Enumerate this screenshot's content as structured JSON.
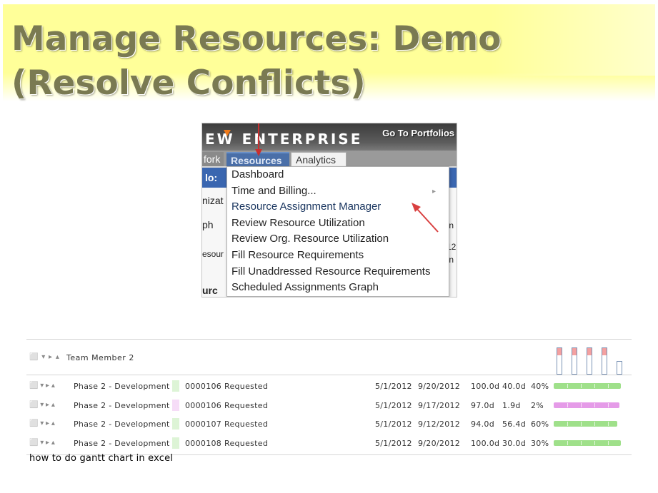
{
  "slide": {
    "title_line1": "Manage Resources: Demo",
    "title_line2": "(Resolve Conflicts)"
  },
  "app": {
    "brand": "EW ENTERPRISE",
    "go_to_portfolios": "Go To Portfolios",
    "tabs": [
      "fork",
      "Resources",
      "Analytics"
    ],
    "behind_fragments": [
      "lo:",
      "nizat",
      "ph",
      "esour",
      "urc",
      "In",
      "12",
      "In"
    ],
    "menu": {
      "items": [
        "Dashboard",
        "Time and Billing...",
        "Resource Assignment Manager",
        "Review Resource Utilization",
        "Review Org. Resource Utilization",
        "Fill Resource Requirements",
        "Fill Unaddressed Resource Requirements",
        "Scheduled Assignments Graph"
      ],
      "highlighted_item": "Resource Assignment Manager",
      "submenu_glyph": "▸"
    },
    "colors": {
      "resources_tab": "#4a6fa8",
      "annotation_arrow": "#d94040",
      "brand_mark": "#f07a1a"
    }
  },
  "gantt": {
    "group_row": {
      "controls": "⬜ ▾ ▸ ▴",
      "label": "Team Member 2",
      "histogram_levels": [
        1.0,
        1.0,
        1.0,
        1.0,
        0.5
      ]
    },
    "rows": [
      {
        "phase": "Phase 2 - Development",
        "id": "0000106",
        "status": "Requested",
        "start": "5/1/2012",
        "finish": "9/20/2012",
        "work": "100.0d",
        "actual": "40.0d",
        "pct": "40%",
        "color": "#9fe08a",
        "bar_fraction": 1.0
      },
      {
        "phase": "Phase 2 - Development",
        "id": "0000106",
        "status": "Requested",
        "start": "5/1/2012",
        "finish": "9/17/2012",
        "work": "97.0d",
        "actual": "1.9d",
        "pct": "2%",
        "color": "#e59be8",
        "bar_fraction": 0.98
      },
      {
        "phase": "Phase 2 - Development",
        "id": "0000107",
        "status": "Requested",
        "start": "5/1/2012",
        "finish": "9/12/2012",
        "work": "94.0d",
        "actual": "56.4d",
        "pct": "60%",
        "color": "#9fe08a",
        "bar_fraction": 0.95
      },
      {
        "phase": "Phase 2 - Development",
        "id": "0000108",
        "status": "Requested",
        "start": "5/1/2012",
        "finish": "9/20/2012",
        "work": "100.0d",
        "actual": "30.0d",
        "pct": "30%",
        "color": "#9fe08a",
        "bar_fraction": 1.0
      }
    ]
  },
  "caption": "how to do gantt chart in excel"
}
